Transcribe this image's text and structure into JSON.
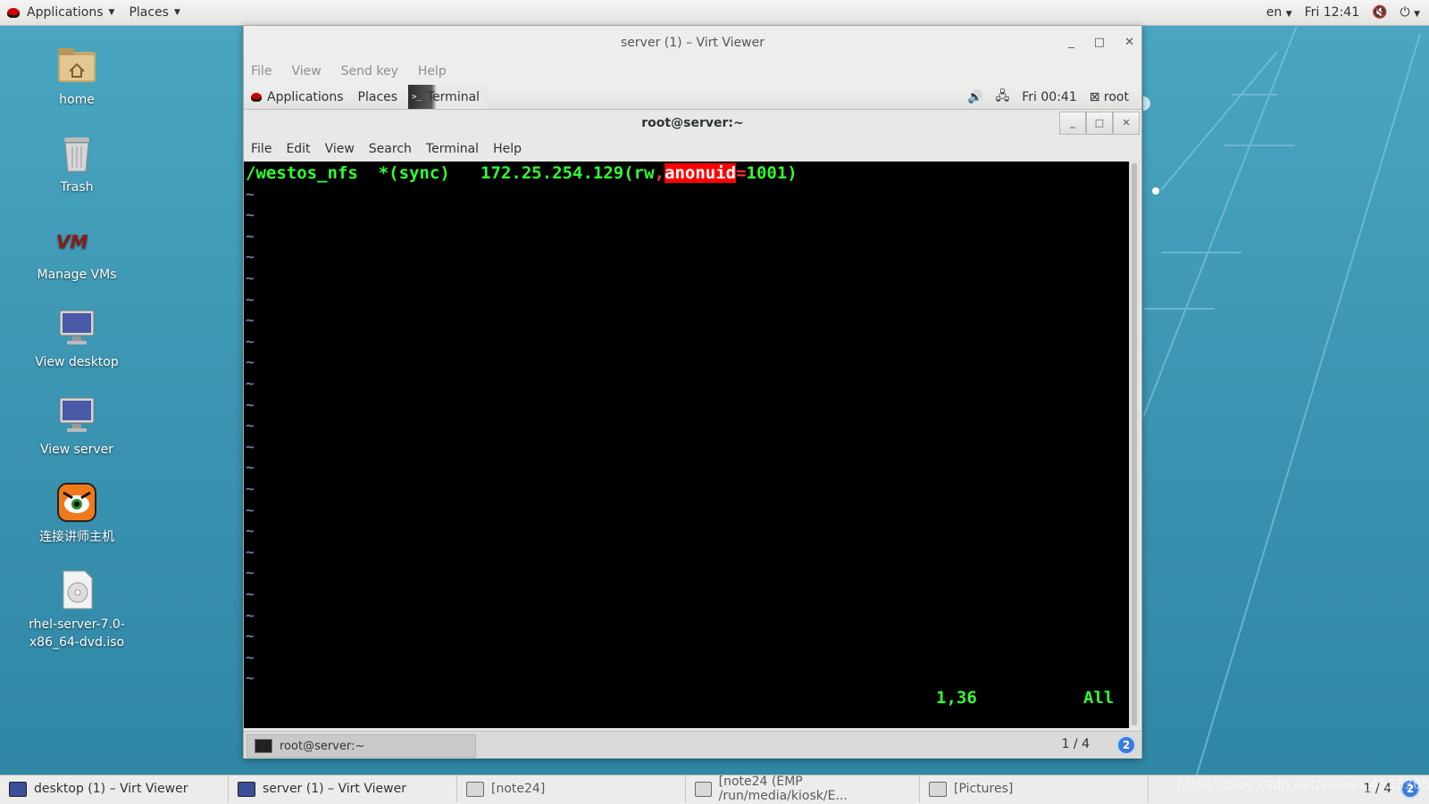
{
  "host_topbar": {
    "applications": "Applications",
    "places": "Places",
    "lang": "en",
    "clock": "Fri 12:41"
  },
  "desktop_icons": [
    {
      "label": "home"
    },
    {
      "label": "Trash"
    },
    {
      "label": "Manage VMs"
    },
    {
      "label": "View desktop"
    },
    {
      "label": "View server"
    },
    {
      "label": "连接讲师主机"
    },
    {
      "label": "rhel-server-7.0-x86_64-dvd.iso"
    }
  ],
  "vv_window": {
    "title": "server (1) – Virt Viewer",
    "menu": [
      "File",
      "View",
      "Send key",
      "Help"
    ]
  },
  "guest_topbar": {
    "applications": "Applications",
    "places": "Places",
    "terminal": "Terminal",
    "clock": "Fri 00:41",
    "user": "root"
  },
  "terminal_window": {
    "title": "root@server:~",
    "menu": [
      "File",
      "Edit",
      "View",
      "Search",
      "Terminal",
      "Help"
    ]
  },
  "terminal_content": {
    "line_prefix": "/westos_nfs  *(sync)   172.25.254.129(rw",
    "comma": ",",
    "highlight": "anonuid",
    "equals": "=",
    "line_suffix": "1001)",
    "tilde": "~",
    "status_pos": "1,36",
    "status_scope": "All"
  },
  "guest_bottom": {
    "task": "root@server:~",
    "pager": "1 / 4",
    "badge": "2"
  },
  "taskbar": {
    "items": [
      "desktop (1) – Virt Viewer",
      "server (1) – Virt Viewer",
      "[note24]",
      "[note24 (EMP /run/media/kiosk/E...",
      "[Pictures]"
    ],
    "pager": "1 / 4",
    "badge": "2"
  },
  "watermark": "https://blog.csdn.net/weixin_45233652"
}
